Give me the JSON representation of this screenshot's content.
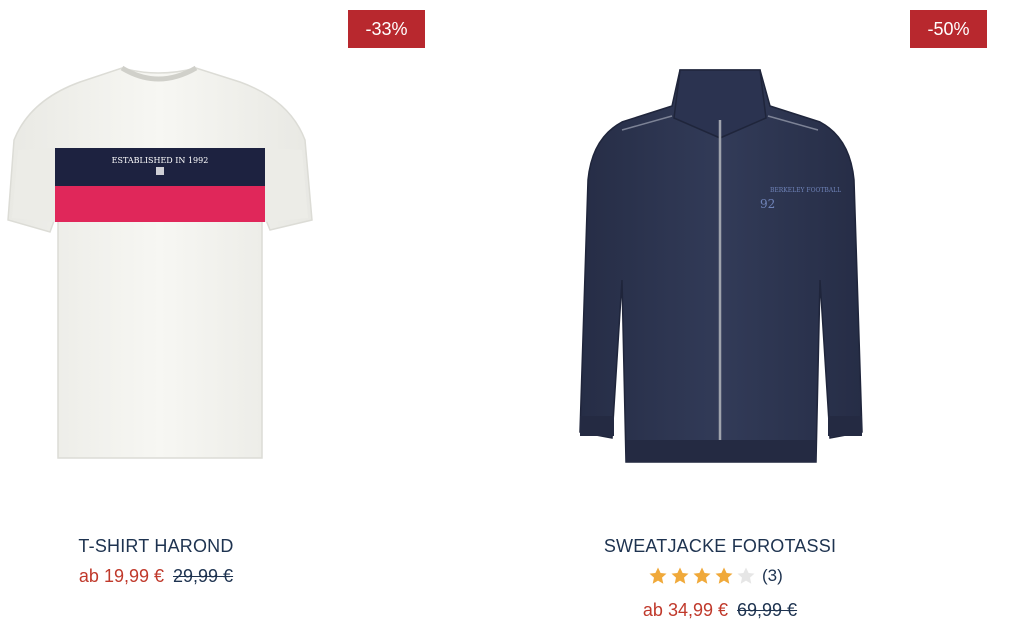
{
  "products": [
    {
      "badge": "-33%",
      "title": "T-SHIRT HAROND",
      "price_from": "ab 19,99 €",
      "price_old": "29,99 €",
      "print_text": "ESTABLISHED IN 1992",
      "colors": {
        "stripe_navy": "#1d2240",
        "stripe_red": "#e0275a",
        "body": "#f4f4f0"
      }
    },
    {
      "badge": "-50%",
      "title": "SWEATJACKE FOROTASSI",
      "rating_value": 4,
      "rating_max": 5,
      "rating_count": "(3)",
      "price_from": "ab 34,99 €",
      "price_old": "69,99 €",
      "print_number": "92",
      "colors": {
        "body": "#2e3651",
        "star_filled": "#f0a93a",
        "star_empty": "#e6e6e6"
      }
    }
  ],
  "colors": {
    "badge_bg": "#b8282e",
    "price_sale": "#c0392b",
    "text_navy": "#1e3350"
  }
}
